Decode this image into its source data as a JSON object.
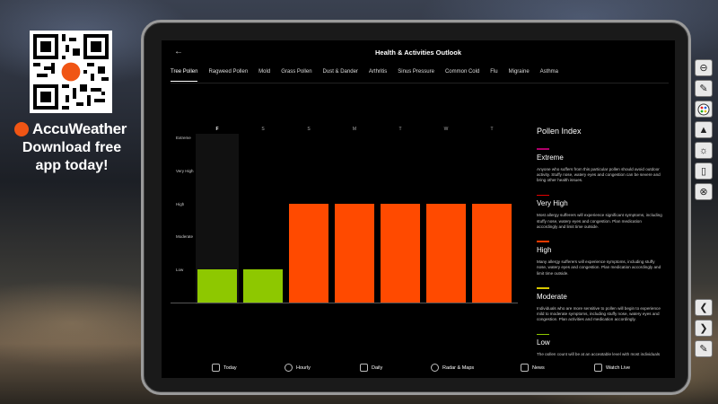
{
  "promo": {
    "brand_name": "AccuWeather",
    "line1": "Download free",
    "line2": "app today!"
  },
  "app": {
    "title": "Health & Activities Outlook",
    "back_icon": "back-arrow-icon",
    "tabs": [
      {
        "label": "Tree Pollen",
        "active": true
      },
      {
        "label": "Ragweed Pollen"
      },
      {
        "label": "Mold"
      },
      {
        "label": "Grass Pollen"
      },
      {
        "label": "Dust & Dander"
      },
      {
        "label": "Arthritis"
      },
      {
        "label": "Sinus Pressure"
      },
      {
        "label": "Common Cold"
      },
      {
        "label": "Flu"
      },
      {
        "label": "Migraine"
      },
      {
        "label": "Asthma"
      }
    ]
  },
  "chart_data": {
    "type": "bar",
    "categories": [
      "F",
      "S",
      "S",
      "M",
      "T",
      "W",
      "T"
    ],
    "y_levels": [
      "Low",
      "Moderate",
      "High",
      "Very High",
      "Extreme"
    ],
    "values": [
      1,
      1,
      3,
      3,
      3,
      3,
      3
    ],
    "bar_colors": [
      "#8ec800",
      "#8ec800",
      "#ff4a00",
      "#ff4a00",
      "#ff4a00",
      "#ff4a00",
      "#ff4a00"
    ],
    "ylim": [
      0,
      5
    ],
    "highlighted_category_index": 0
  },
  "index_panel": {
    "title": "Pollen Index",
    "levels": [
      {
        "name": "Extreme",
        "color": "#b0006a",
        "desc": "Anyone who suffers from this particular pollen should avoid outdoor activity. Stuffy nose, watery eyes and congestion can be severe and bring other health issues."
      },
      {
        "name": "Very High",
        "color": "#e00000",
        "desc": "Most allergy sufferers will experience significant symptoms, including stuffy nose, watery eyes and congestion. Plan medication accordingly and limit time outside."
      },
      {
        "name": "High",
        "color": "#ff3a00",
        "desc": "Many allergy sufferers will experience symptoms, including stuffy nose, watery eyes and congestion. Plan medication accordingly and limit time outside."
      },
      {
        "name": "Moderate",
        "color": "#d8c800",
        "desc": "Individuals who are more sensitive to pollen will begin to experience mild to moderate symptoms, including stuffy nose, watery eyes and congestion. Plan activities and medication accordingly."
      },
      {
        "name": "Low",
        "color": "#8ec800",
        "desc": "The pollen count will be at an acceptable level with most individuals experiencing little to no symptoms. Enjoy"
      }
    ]
  },
  "bottom_nav": [
    {
      "label": "Today",
      "icon": "calendar-today-icon"
    },
    {
      "label": "Hourly",
      "icon": "clock-icon"
    },
    {
      "label": "Daily",
      "icon": "calendar-icon"
    },
    {
      "label": "Radar & Maps",
      "icon": "radar-icon"
    },
    {
      "label": "News",
      "icon": "news-icon"
    },
    {
      "label": "Watch Live",
      "icon": "play-icon"
    }
  ],
  "toolbar": {
    "tools": [
      "minus-circle-icon",
      "pen-icon",
      "palette-icon",
      "fill-icon",
      "brightness-icon",
      "eraser-icon",
      "close-circle-icon"
    ],
    "nav": [
      "prev-icon",
      "next-icon",
      "edit-icon"
    ]
  }
}
